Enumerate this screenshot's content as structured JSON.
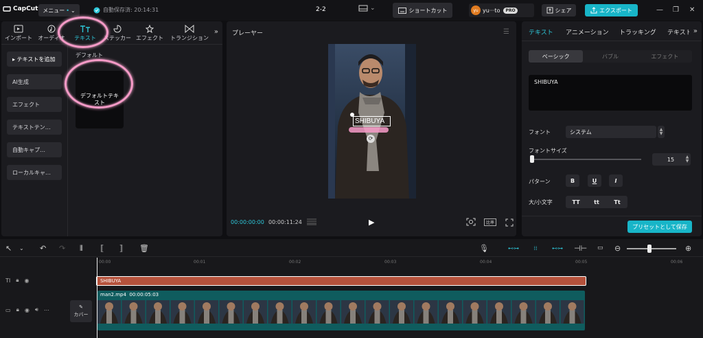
{
  "app": {
    "logo_text": "CapCut",
    "menu_label": "メニュー",
    "autosave_text": "自動保存済: 20:14:31",
    "project_name": "2-2",
    "shortcut_label": "ショートカット",
    "user_name": "yu···to",
    "user_avatar": "yu",
    "pro_badge": "PRO",
    "share_label": "シェア",
    "export_label": "エクスポート",
    "accent_color": "#18b5c8"
  },
  "left_panel": {
    "tabs": [
      {
        "label": "インポート",
        "icon": "import-icon"
      },
      {
        "label": "オーディオ",
        "icon": "audio-icon"
      },
      {
        "label": "テキスト",
        "icon": "text-icon",
        "active": true
      },
      {
        "label": "ステッカー",
        "icon": "sticker-icon"
      },
      {
        "label": "エフェクト",
        "icon": "effect-icon"
      },
      {
        "label": "トランジション",
        "icon": "transition-icon"
      }
    ],
    "side_items": [
      "▸ テキストを追加",
      "AI生成",
      "エフェクト",
      "テキストテン…",
      "自動キャプ…",
      "ローカルキャ…"
    ],
    "section_label": "デフォルト",
    "default_card_text": "デフォルトテキスト"
  },
  "player": {
    "title": "プレーヤー",
    "overlay_text": "SHIBUYA",
    "time_current": "00:00:00:00",
    "time_total": "00:00:11:24",
    "ratio_label": "比率"
  },
  "right_panel": {
    "tabs": [
      "テキスト",
      "アニメーション",
      "トラッキング",
      "テキスト"
    ],
    "segments": [
      "ベーシック",
      "バブル",
      "エフェクト"
    ],
    "text_value": "SHIBUYA",
    "font_label": "フォント",
    "font_value": "システム",
    "font_size_label": "フォントサイズ",
    "font_size_value": "15",
    "pattern_label": "パターン",
    "pattern_buttons": [
      "B",
      "U",
      "I"
    ],
    "case_label": "大/小文字",
    "case_buttons": [
      "TT",
      "tt",
      "Tt"
    ],
    "preset_label": "プリセットとして保存"
  },
  "timeline": {
    "ruler_marks": [
      "00:00",
      "00:01",
      "00:02",
      "00:03",
      "00:04",
      "00:05",
      "00:06"
    ],
    "text_clip_label": "SHIBUYA",
    "video_clip_name": "man2.mp4",
    "video_clip_duration": "00:00:05:03",
    "cover_label": "カバー"
  }
}
